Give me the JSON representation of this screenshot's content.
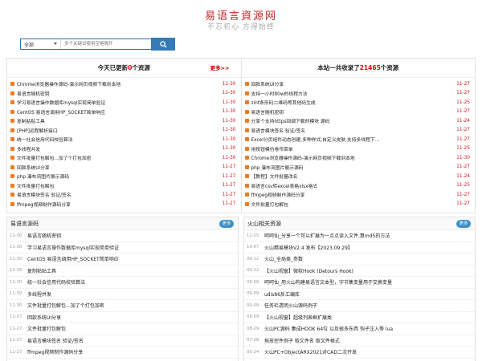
{
  "site": {
    "name": "易语言資源网",
    "slogan": "不忘初心 方得始终"
  },
  "search": {
    "category": "全部",
    "placeholder": "多个关键词使用空格隔开",
    "button_icon": "search-icon"
  },
  "today": {
    "prefix": "今天已更新",
    "count": "0",
    "suffix": "个资源",
    "more": "更多>>",
    "items": [
      {
        "title": "Chrome浏览器操作源码-演示网页视频下载到本地",
        "date": "11-30"
      },
      {
        "title": "易语言随机密钥",
        "date": "11-30"
      },
      {
        "title": "学习易语言操作数据库mysql实现简单验证",
        "date": "11-30"
      },
      {
        "title": "CentOS 易语言调用HP_SOCKET简单响应",
        "date": "11-30"
      },
      {
        "title": "复制粘贴工具",
        "date": "11-30"
      },
      {
        "title": "[PHP]远程解析接口",
        "date": "11-30"
      },
      {
        "title": "统一社会信用代码校验算法",
        "date": "11-30"
      },
      {
        "title": "多线程并发",
        "date": "11-30"
      },
      {
        "title": "文件批量打包解包...加了个打包加密",
        "date": "11-30"
      },
      {
        "title": "回款系统UI分享",
        "date": "11-27"
      },
      {
        "title": "php 瀑布流图片展示源码",
        "date": "11-27"
      },
      {
        "title": "文件批量打包解包",
        "date": "11-27"
      },
      {
        "title": "易语言模块签名 验证/签名",
        "date": "11-27"
      },
      {
        "title": "ffmpeg视频制作源码分享",
        "date": "11-27"
      }
    ]
  },
  "total": {
    "prefix": "本站一共收录了",
    "count": "21465",
    "suffix": "个资源",
    "items": [
      {
        "title": "回款系统UI分享",
        "date": "11-27"
      },
      {
        "title": "支持一小时80w的线程方法",
        "date": "11-27"
      },
      {
        "title": "zint条形码二维码等其他码生成",
        "date": "11-25"
      },
      {
        "title": "易语言随机密钥",
        "date": "11-27"
      },
      {
        "title": "分享个支持https回调下载的模块 源码",
        "date": "11-24"
      },
      {
        "title": "易语言模块签名 验证/签名",
        "date": "11-27"
      },
      {
        "title": "Excel分页组件动态创建,多种样式,自定义皮肤,支持多线程下...",
        "date": "11-27"
      },
      {
        "title": "用按钮模仿卷帘菜单",
        "date": "11-25"
      },
      {
        "title": "Chrome浏览器操作源码-演示网页视频下载到本地",
        "date": "11-30"
      },
      {
        "title": "php 瀑布流图片展示源码",
        "date": "11-27"
      },
      {
        "title": "【教程】文件批量改名",
        "date": "11-24"
      },
      {
        "title": "易语言csv转excel表格xlsx格式",
        "date": "11-25"
      },
      {
        "title": "ffmpeg视频制作源码分享",
        "date": "11-27"
      },
      {
        "title": "文件批量打包解包",
        "date": "11-27"
      }
    ]
  },
  "panel_left": {
    "title": "易语言源码",
    "more": "更多",
    "items": [
      {
        "date": "11-30",
        "title": "易语言随机密钥"
      },
      {
        "date": "11-30",
        "title": "学习易语言操作数据库mysql实现简单验证"
      },
      {
        "date": "11-30",
        "title": "CentOS 易语言调用HP_SOCKET简单响应"
      },
      {
        "date": "11-30",
        "title": "复制粘贴工具"
      },
      {
        "date": "11-30",
        "title": "统一社会信用代码校验算法"
      },
      {
        "date": "11-30",
        "title": "多线程并发"
      },
      {
        "date": "11-30",
        "title": "文件批量打包解包...加了个打包加密"
      },
      {
        "date": "11-27",
        "title": "回款系统UI分享"
      },
      {
        "date": "11-27",
        "title": "文件批量打包解包"
      },
      {
        "date": "11-27",
        "title": "易语言模块签名 验证/签名"
      },
      {
        "date": "11-27",
        "title": "ffmpeg视频制作源码分享"
      },
      {
        "date": "11-27",
        "title": "K线制图框架模块_双缓多图层【无需模块】"
      }
    ]
  },
  "panel_right": {
    "title": "火山相关资源",
    "more": "更多",
    "items": [
      {
        "date": "11-15",
        "title": "呵呵仙_分享一个可以扩展为一点点读入文件,算md5的方法"
      },
      {
        "date": "10-07",
        "title": "火山精易模块V2.4 发布【2023.09.29】"
      },
      {
        "date": "09-12",
        "title": "火山_全局类_参数"
      },
      {
        "date": "09-12",
        "title": "【火山视窗】微软Hook (Detours Hook)"
      },
      {
        "date": "09-09",
        "title": "呵呵仙_用火山构建易语言文本型，字节集变量用于交换变量"
      },
      {
        "date": "09-09",
        "title": "udis86反汇编库"
      },
      {
        "date": "09-09",
        "title": "任务栏透明火山源码例子"
      },
      {
        "date": "09-09",
        "title": "【火山视窗】超级列表框扩展类"
      },
      {
        "date": "08-29",
        "title": "火山PC源码 集成HOOK 64位 以及很多东西 钩子注入等 lua"
      },
      {
        "date": "07-28",
        "title": "拖放控件例子 取文件名 取文件格式"
      },
      {
        "date": "05-24",
        "title": "火山PC+ObjectARX2021对CAD二次开发"
      },
      {
        "date": "05-24",
        "title": "【MQTT3.1.1客户端】协议封装，无三方模块"
      }
    ]
  }
}
